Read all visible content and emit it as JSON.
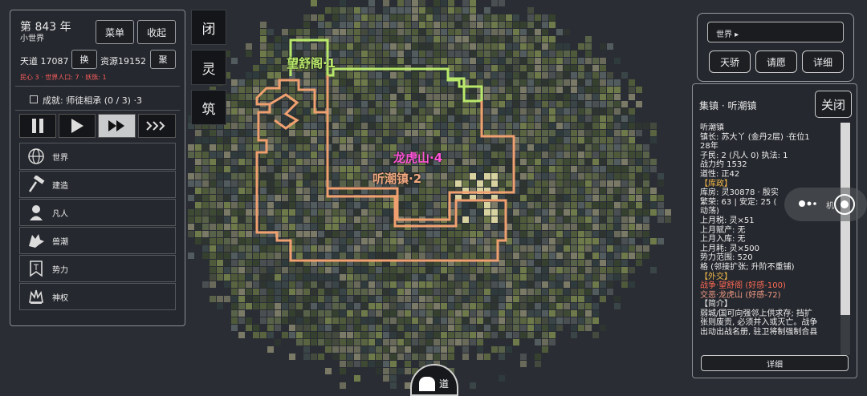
{
  "year_panel": {
    "year": "第 843 年",
    "world_name": "小世界",
    "menu_label": "菜单",
    "collapse_label": "收起",
    "tiandao": "天道 17087",
    "swap_label": "换",
    "resources": "资源19152",
    "gather_label": "聚",
    "status_line": "民心 3 · 世界人口: 7 · 妖族: 1",
    "achievement": "成就: 师徒相承 (0 / 3) ·3",
    "menu_items": [
      {
        "label": "世界",
        "icon": "globe-icon"
      },
      {
        "label": "建造",
        "icon": "hammer-icon"
      },
      {
        "label": "凡人",
        "icon": "person-icon"
      },
      {
        "label": "兽潮",
        "icon": "wolf-icon"
      },
      {
        "label": "势力",
        "icon": "banner-icon"
      },
      {
        "label": "神权",
        "icon": "crown-icon"
      }
    ]
  },
  "side_buttons": [
    "闭",
    "灵",
    "筑"
  ],
  "map_labels": [
    {
      "text": "望舒阁·1",
      "color": "#b8e86a"
    },
    {
      "text": "龙虎山·4",
      "color": "#ff55d8"
    },
    {
      "text": "听潮镇·2",
      "color": "#f0a880"
    }
  ],
  "world_box": {
    "search_value": "世界 ▸",
    "buttons": [
      "天骄",
      "请愿",
      "详细"
    ]
  },
  "info_panel": {
    "title": "集镇 · 听潮镇",
    "close_label": "关闭",
    "detail_label": "详细",
    "lines": [
      {
        "text": "听潮镇",
        "style": "normal"
      },
      {
        "text": "镇长: 苏大丫 (金丹2层) ·在位1",
        "style": "normal"
      },
      {
        "text": "28年",
        "style": "normal"
      },
      {
        "text": "子民: 2 (凡人 0)    执法: 1",
        "style": "normal"
      },
      {
        "text": "战力约 1532",
        "style": "normal"
      },
      {
        "text": "道性: 正42",
        "style": "normal"
      },
      {
        "text": "【库政】",
        "style": "hdr"
      },
      {
        "text": "库房: 灵30878 · 殷实",
        "style": "normal"
      },
      {
        "text": "繁荣: 63 | 安定: 25 (",
        "style": "normal"
      },
      {
        "text": "动荡)",
        "style": "normal"
      },
      {
        "text": "上月税: 灵×51",
        "style": "normal"
      },
      {
        "text": "上月赋产: 无",
        "style": "normal"
      },
      {
        "text": "上月入库: 无",
        "style": "normal"
      },
      {
        "text": "上月耗: 灵×500",
        "style": "normal"
      },
      {
        "text": "势力范围: 520",
        "style": "normal"
      },
      {
        "text": "格 (邻接扩张; 升阶不重铺)",
        "style": "normal"
      },
      {
        "text": "【外交】",
        "style": "hdr"
      },
      {
        "text": "战争·望舒阁 (好感-100)",
        "style": "red"
      },
      {
        "text": "交恶·龙虎山 (好感-72)",
        "style": "salmon"
      },
      {
        "text": "【简介】",
        "style": "normal"
      },
      {
        "text": "弱城/国可向强邻上供求存; 挡扩",
        "style": "normal"
      },
      {
        "text": "张则废贡, 必须并入或灭亡。战争",
        "style": "normal"
      },
      {
        "text": "出动出战名册, 驻卫将制强制合县",
        "style": "normal"
      }
    ]
  },
  "overlay_text": "机",
  "bottom_badge": "道",
  "colors": {
    "background": "#2a2d33",
    "wangshu_border": "#b8e86a",
    "tingchao_border": "#f0a070",
    "longhu_label": "#ff55d8"
  }
}
